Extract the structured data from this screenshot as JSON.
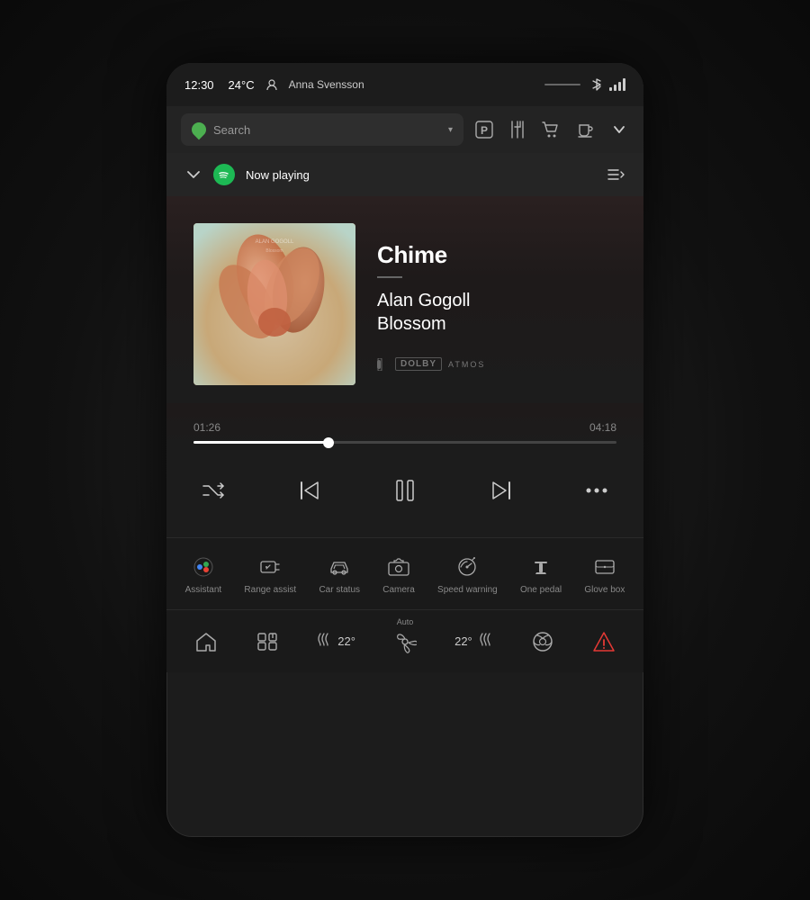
{
  "statusBar": {
    "time": "12:30",
    "temp": "24°C",
    "user": "Anna Svensson",
    "lineSeparator": "——"
  },
  "navBar": {
    "searchPlaceholder": "Search",
    "icons": [
      "parking",
      "restaurant",
      "cart",
      "cafe"
    ]
  },
  "nowPlaying": {
    "label": "Now playing",
    "chevron": "∨",
    "playlistIcon": "☰"
  },
  "track": {
    "title": "Chime",
    "artist": "Alan Gogoll",
    "album": "Blossom",
    "dolby": "𝔻 DOLBY",
    "atmos": "ATMOS",
    "currentTime": "01:26",
    "totalTime": "04:18",
    "progressPercent": 32
  },
  "controls": {
    "shuffle": "shuffle",
    "prev": "prev",
    "pause": "pause",
    "next": "next",
    "more": "more"
  },
  "quickAccess": [
    {
      "id": "assistant",
      "label": "Assistant",
      "icon": "●"
    },
    {
      "id": "range-assist",
      "label": "Range assist",
      "icon": "⚡"
    },
    {
      "id": "car-status",
      "label": "Car status",
      "icon": "🚗"
    },
    {
      "id": "camera",
      "label": "Camera",
      "icon": "📷"
    },
    {
      "id": "speed-warning",
      "label": "Speed warning",
      "icon": "⚠"
    },
    {
      "id": "one-pedal",
      "label": "One pedal",
      "icon": "〇"
    },
    {
      "id": "glove-box",
      "label": "Glove box",
      "icon": "□"
    }
  ],
  "bottomNav": [
    {
      "id": "home",
      "label": "",
      "icon": "⌂"
    },
    {
      "id": "apps",
      "label": "",
      "icon": "⊞"
    },
    {
      "id": "climate-left",
      "label": "",
      "temp": "22°",
      "icon": "temp-left"
    },
    {
      "id": "fan",
      "label": "Auto",
      "icon": "fan",
      "isAuto": true
    },
    {
      "id": "climate-right",
      "label": "",
      "temp": "22°",
      "icon": "temp-right"
    },
    {
      "id": "gaming",
      "label": "",
      "icon": "🎮"
    },
    {
      "id": "warning",
      "label": "",
      "icon": "⚠",
      "isWarning": true
    }
  ],
  "colors": {
    "accent": "#1DB954",
    "background": "#1c1c1c",
    "surface": "#252525",
    "text": "#ffffff",
    "textMuted": "#888888",
    "warning": "#e53935"
  }
}
